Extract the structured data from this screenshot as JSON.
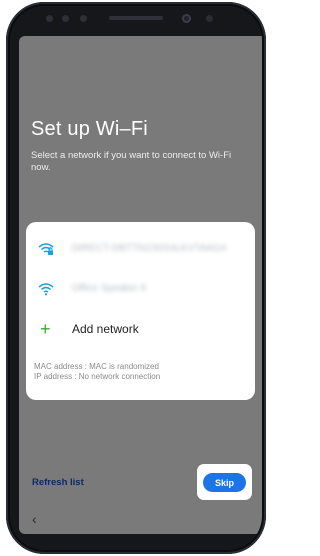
{
  "setup": {
    "title": "Set up Wi–Fi",
    "subtitle": "Select a network if you want to connect to Wi-Fi now."
  },
  "networks": [
    {
      "name": "DIRECT-DBTTN1S0S4LKVTAAG4",
      "icon": "wifi-lock-icon"
    },
    {
      "name": "Office Speaker 6",
      "icon": "wifi-icon"
    }
  ],
  "add_network": {
    "label": "Add network",
    "icon": "plus-icon"
  },
  "info": {
    "mac": "MAC address : MAC is randomized",
    "ip": "IP address : No network connection"
  },
  "footer": {
    "refresh_label": "Refresh list",
    "skip_label": "Skip",
    "back_icon": "chevron-left-icon"
  },
  "colors": {
    "screen_dim": "#7a7a7a",
    "skip_button": "#1c74e6",
    "refresh_link": "#0c2a63",
    "add_icon": "#3aa935",
    "wifi_icon": "#1a9fd6"
  }
}
